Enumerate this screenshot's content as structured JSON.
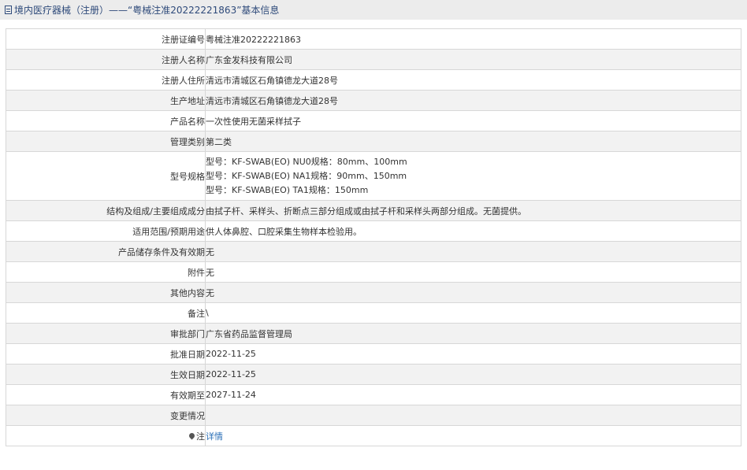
{
  "header": {
    "title": "境内医疗器械（注册）——“粤械注准20222221863”基本信息"
  },
  "rows": [
    {
      "label": "注册证编号",
      "value": "粤械注准20222221863"
    },
    {
      "label": "注册人名称",
      "value": "广东金发科技有限公司"
    },
    {
      "label": "注册人住所",
      "value": "清远市清城区石角镇德龙大道28号"
    },
    {
      "label": "生产地址",
      "value": "清远市清城区石角镇德龙大道28号"
    },
    {
      "label": "产品名称",
      "value": "一次性使用无菌采样拭子"
    },
    {
      "label": "管理类别",
      "value": "第二类"
    },
    {
      "label": "型号规格",
      "lines": [
        "型号：KF-SWAB(EO) NU0规格：80mm、100mm",
        "型号：KF-SWAB(EO) NA1规格：90mm、150mm",
        "型号：KF-SWAB(EO) TA1规格：150mm"
      ]
    },
    {
      "label": "结构及组成/主要组成成分",
      "value": "由拭子杆、采样头、折断点三部分组成或由拭子杆和采样头两部分组成。无菌提供。"
    },
    {
      "label": "适用范围/预期用途",
      "value": "供人体鼻腔、口腔采集生物样本检验用。"
    },
    {
      "label": "产品储存条件及有效期",
      "value": "无"
    },
    {
      "label": "附件",
      "value": "无"
    },
    {
      "label": "其他内容",
      "value": "无"
    },
    {
      "label": "备注",
      "value": "\\"
    },
    {
      "label": "审批部门",
      "value": "广东省药品监督管理局"
    },
    {
      "label": "批准日期",
      "value": "2022-11-25"
    },
    {
      "label": "生效日期",
      "value": "2022-11-25"
    },
    {
      "label": "有效期至",
      "value": "2027-11-24"
    },
    {
      "label": "变更情况",
      "value": ""
    },
    {
      "label": "注",
      "value": "详情",
      "icon": "pin-icon"
    }
  ]
}
